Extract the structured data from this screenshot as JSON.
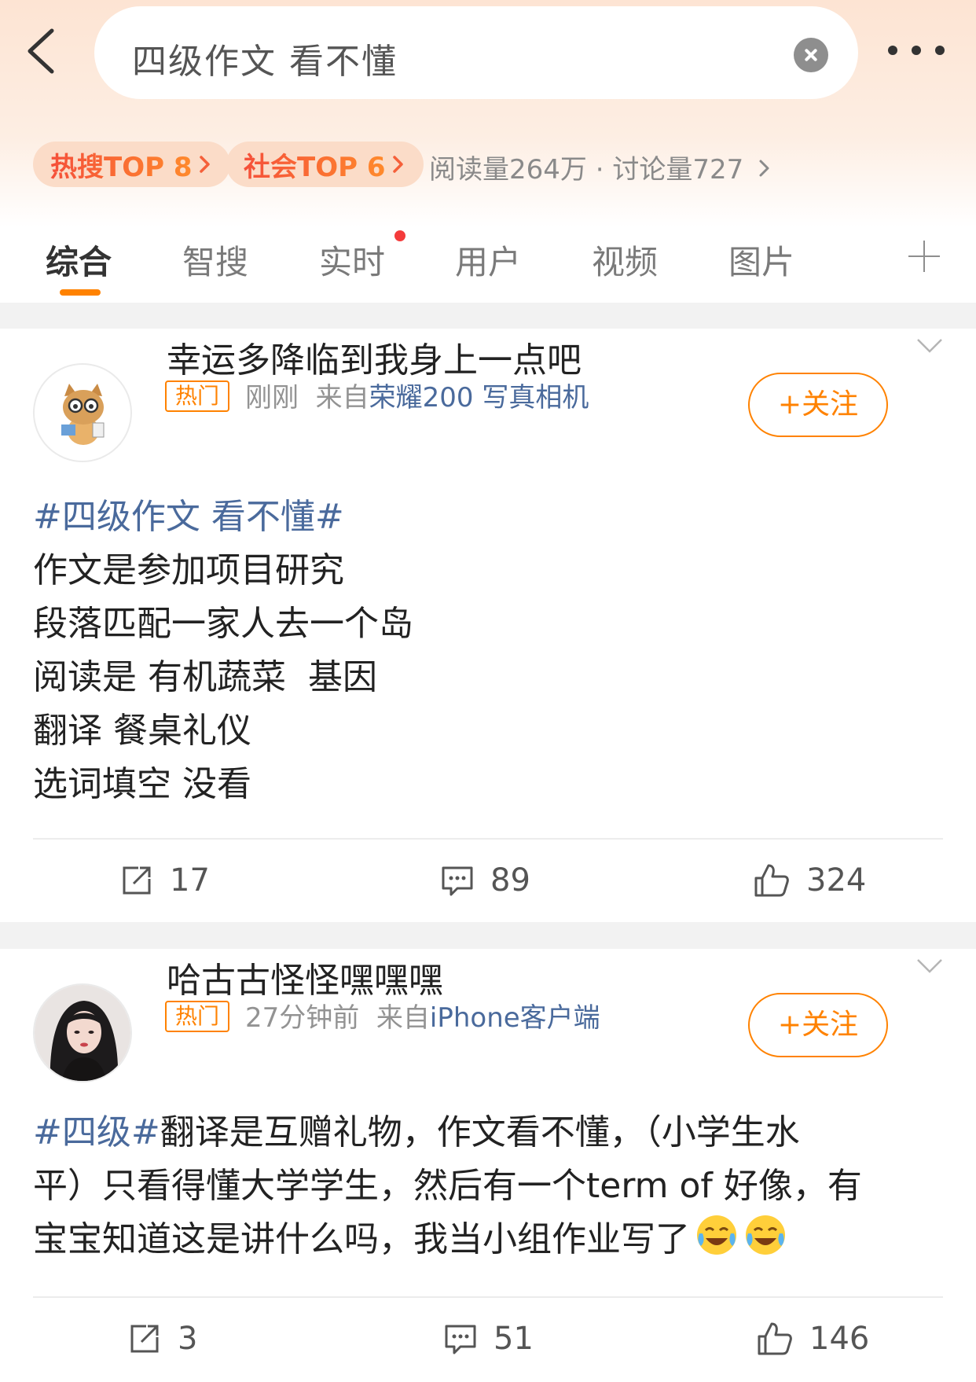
{
  "search": {
    "query": "四级作文 看不懂"
  },
  "rank": {
    "hot": "热搜TOP 8",
    "society": "社会TOP 6",
    "stats": "阅读量264万 · 讨论量727"
  },
  "tabs": [
    "综合",
    "智搜",
    "实时",
    "用户",
    "视频",
    "图片"
  ],
  "posts": [
    {
      "username": "幸运多降临到我身上一点吧",
      "tag": "热门",
      "time": "刚刚",
      "from_label": "来自",
      "source": "荣耀200 写真相机",
      "follow": "+关注",
      "topic": "#四级作文 看不懂#",
      "lines": [
        "作文是参加项目研究",
        "段落匹配一家人去一个岛",
        "阅读是 有机蔬菜  基因",
        "翻译 餐桌礼仪",
        "选词填空 没看"
      ],
      "reposts": "17",
      "comments": "89",
      "likes": "324"
    },
    {
      "username": "哈古古怪怪嘿嘿嘿",
      "tag": "热门",
      "time": "27分钟前",
      "from_label": "来自",
      "source": "iPhone客户端",
      "follow": "+关注",
      "topic": "#四级#",
      "line1_rest": "翻译是互赠礼物，作文看不懂，（小学生水",
      "line2": "平）只看得懂大学学生，然后有一个term of 好像，有",
      "line3": "宝宝知道这是讲什么吗，我当小组作业写了",
      "emoji": "laughing-crying-emoji",
      "reposts": "3",
      "comments": "51",
      "likes": "146"
    }
  ],
  "colors": {
    "accent": "#ff8200",
    "link": "#4a6a9c",
    "badge_dot": "#f43b3b"
  }
}
